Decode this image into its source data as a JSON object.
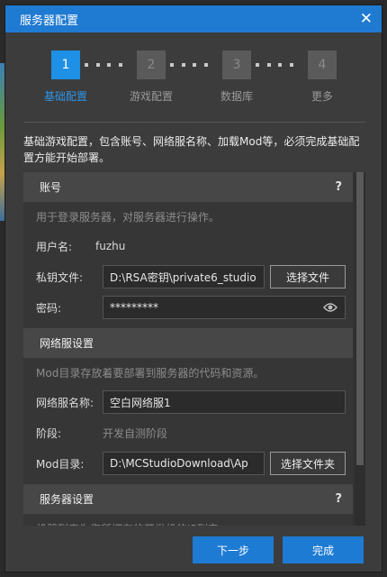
{
  "dialog": {
    "title": "服务器配置",
    "close": "✕"
  },
  "steps": [
    {
      "num": "1",
      "label": "基础配置",
      "active": true
    },
    {
      "num": "2",
      "label": "游戏配置",
      "active": false
    },
    {
      "num": "3",
      "label": "数据库",
      "active": false
    },
    {
      "num": "4",
      "label": "更多",
      "active": false
    }
  ],
  "description": "基础游戏配置，包含账号、网络服名称、加载Mod等，必须完成基础配置方能开始部署。",
  "account": {
    "header": "账号",
    "help": "?",
    "hint": "用于登录服务器，对服务器进行操作。",
    "username_label": "用户名:",
    "username_value": "fuzhu",
    "key_label": "私钥文件:",
    "key_value": "D:\\RSA密钥\\private6_studio",
    "choose_file": "选择文件",
    "password_label": "密码:",
    "password_value": "*********"
  },
  "network": {
    "header": "网络服设置",
    "hint": "Mod目录存放着要部署到服务器的代码和资源。",
    "name_label": "网络服名称:",
    "name_value": "空白网络服1",
    "stage_label": "阶段:",
    "stage_value": "开发自测阶段",
    "mod_label": "Mod目录:",
    "mod_value": "D:\\MCStudioDownload\\Ap",
    "choose_folder": "选择文件夹"
  },
  "server": {
    "header": "服务器设置",
    "help": "?",
    "hint": "机器列表为您所拥有的开发机的IP列表"
  },
  "footer": {
    "next": "下一步",
    "finish": "完成"
  },
  "colors": {
    "accent": "#1e7bd4",
    "step_active": "#1e90e6",
    "title_bar": "#1f7ad1"
  }
}
